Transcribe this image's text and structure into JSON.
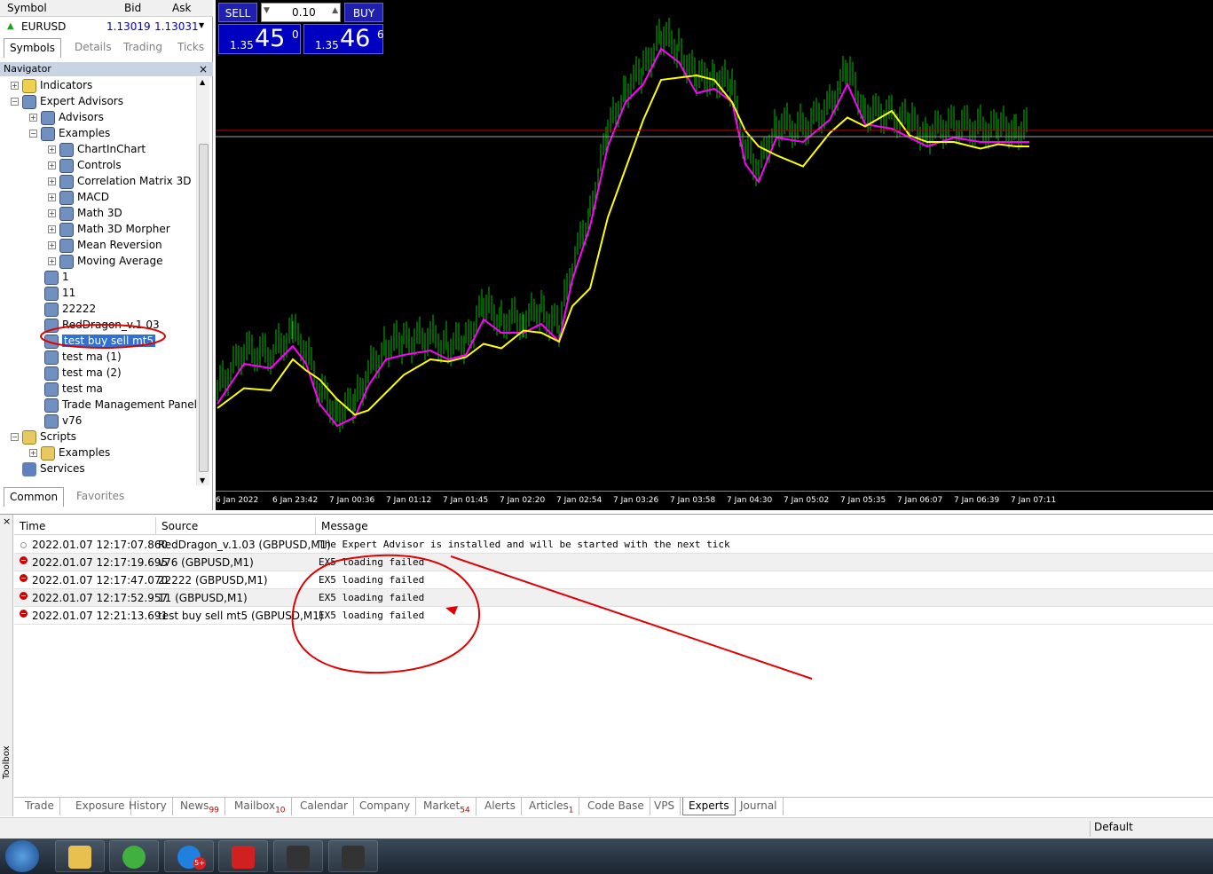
{
  "market_watch": {
    "headers": {
      "symbol": "Symbol",
      "bid": "Bid",
      "ask": "Ask"
    },
    "row": {
      "symbol": "EURUSD",
      "bid": "1.13019",
      "ask": "1.13031"
    },
    "tabs": [
      "Symbols",
      "Details",
      "Trading",
      "Ticks"
    ]
  },
  "navigator": {
    "title": "Navigator",
    "close": "×",
    "items": {
      "indicators": "Indicators",
      "expert_advisors": "Expert Advisors",
      "advisors": "Advisors",
      "examples": "Examples",
      "chartinchart": "ChartInChart",
      "controls": "Controls",
      "correlation": "Correlation Matrix 3D",
      "macd": "MACD",
      "math3d": "Math 3D",
      "morpher": "Math 3D Morpher",
      "meanrev": "Mean Reversion",
      "movavg": "Moving Average",
      "ea1": "1",
      "ea11": "11",
      "ea22222": "22222",
      "reddragon": "RedDragon_v.1.03",
      "testbuysell": "test buy sell mt5",
      "testma1": "test ma (1)",
      "testma2": "test ma (2)",
      "testma": "test ma",
      "tmp": "Trade Management Panel",
      "v76": "v76",
      "scripts": "Scripts",
      "scripts_examples": "Examples",
      "services": "Services"
    },
    "tabs": [
      "Common",
      "Favorites"
    ]
  },
  "trade_panel": {
    "sell": "SELL",
    "buy": "BUY",
    "lot": "0.10",
    "sell_small": "1.35",
    "sell_big": "45",
    "sell_sup": "0",
    "buy_small": "1.35",
    "buy_big": "46",
    "buy_sup": "6"
  },
  "chart_xaxis": [
    "6 Jan 2022",
    "6 Jan 23:42",
    "7 Jan 00:36",
    "7 Jan 01:12",
    "7 Jan 01:45",
    "7 Jan 02:20",
    "7 Jan 02:54",
    "7 Jan 03:26",
    "7 Jan 03:58",
    "7 Jan 04:30",
    "7 Jan 05:02",
    "7 Jan 05:35",
    "7 Jan 06:07",
    "7 Jan 06:39",
    "7 Jan 07:11"
  ],
  "toolbox": {
    "side_label": "Toolbox",
    "close": "×",
    "columns": {
      "time": "Time",
      "source": "Source",
      "message": "Message"
    },
    "rows": [
      {
        "time": "2022.01.07 12:17:07.860",
        "source": "RedDragon_v.1.03 (GBPUSD,M1)",
        "message": "The Expert Advisor is installed and will be started with the next tick",
        "level": "info"
      },
      {
        "time": "2022.01.07 12:17:19.695",
        "source": "v76 (GBPUSD,M1)",
        "message": "EX5 loading failed",
        "level": "error"
      },
      {
        "time": "2022.01.07 12:17:47.070",
        "source": "22222 (GBPUSD,M1)",
        "message": "EX5 loading failed",
        "level": "error"
      },
      {
        "time": "2022.01.07 12:17:52.957",
        "source": "11 (GBPUSD,M1)",
        "message": "EX5 loading failed",
        "level": "error"
      },
      {
        "time": "2022.01.07 12:21:13.691",
        "source": "test buy sell mt5 (GBPUSD,M1)",
        "message": "EX5 loading failed",
        "level": "error"
      }
    ],
    "tabs": {
      "trade": "Trade",
      "exposure": "Exposure",
      "history": "History",
      "news": "News",
      "news_count": "99",
      "mailbox": "Mailbox",
      "mailbox_count": "10",
      "calendar": "Calendar",
      "company": "Company",
      "market": "Market",
      "market_count": "54",
      "alerts": "Alerts",
      "articles": "Articles",
      "articles_count": "1",
      "codebase": "Code Base",
      "vps": "VPS",
      "experts": "Experts",
      "journal": "Journal"
    }
  },
  "status_bar": {
    "profile": "Default"
  },
  "taskbar": {
    "zalo_badge": "5+"
  },
  "colors": {
    "ma_fast": "#ff00ff",
    "ma_slow": "#ffff00",
    "candles": "#00c000",
    "bid_line": "#c00000",
    "annotation": "#e00000"
  }
}
